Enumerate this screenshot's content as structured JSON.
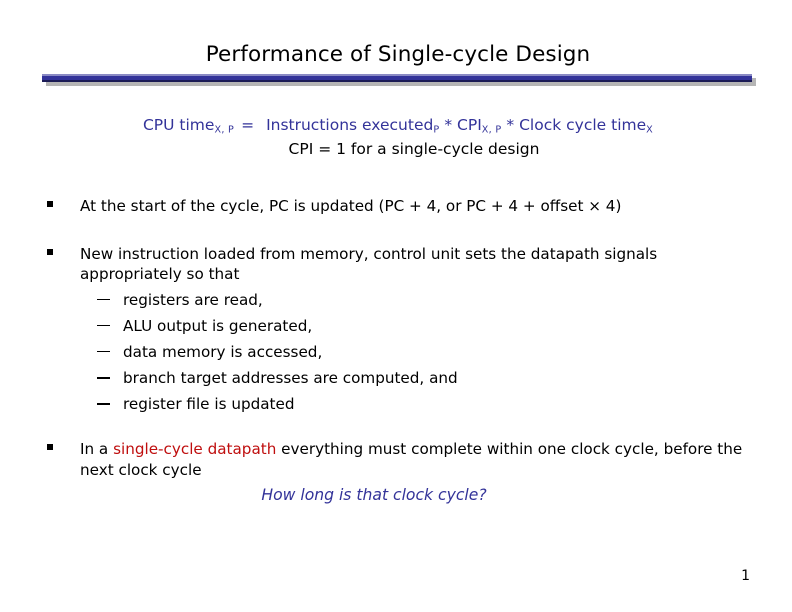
{
  "slide": {
    "title": "Performance of Single-cycle Design",
    "page_number": "1",
    "colors": {
      "accent_blue": "#333399",
      "highlight_red": "#bf0e0e",
      "text_black": "#000000",
      "rule_shadow": "#b5b5b5"
    }
  },
  "formula": {
    "line1": {
      "lhs_main": "CPU time",
      "lhs_sub": "X, P",
      "equals": "=",
      "term1_main": "Instructions executed",
      "term1_sub": "P",
      "op1": "*",
      "term2_main": "CPI",
      "term2_sub": "X, P",
      "op2": "*",
      "term3_main": "Clock cycle time",
      "term3_sub": "X"
    },
    "line2": "CPI = 1 for a single-cycle design"
  },
  "bullets": [
    {
      "marker": "square-bullet",
      "text": "At the start of the cycle, PC is updated (PC + 4, or PC + 4 + offset × 4)"
    },
    {
      "marker": "square-bullet",
      "text": "New instruction loaded from memory, control unit sets the datapath signals appropriately so that",
      "subitems": [
        "registers are read,",
        "ALU output is generated,",
        "data memory is accessed,",
        "branch target addresses are computed, and",
        "register file is updated"
      ]
    },
    {
      "marker": "square-bullet",
      "text_before": "In a ",
      "text_highlight": "single-cycle datapath",
      "text_after": " everything must complete within one clock cycle, before the next clock cycle"
    }
  ],
  "closing_question": "How long is that clock cycle?"
}
